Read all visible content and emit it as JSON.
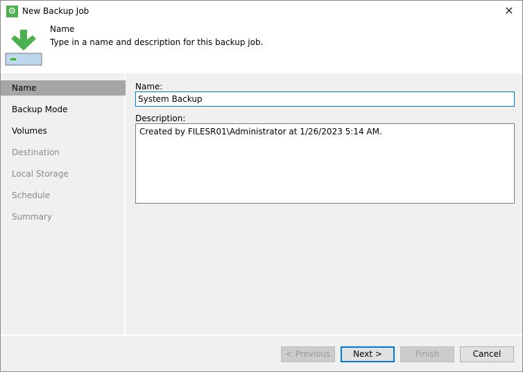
{
  "window": {
    "title": "New Backup Job"
  },
  "header": {
    "title": "Name",
    "description": "Type in a name and description for this backup job."
  },
  "steps": [
    {
      "label": "Name",
      "state": "selected"
    },
    {
      "label": "Backup Mode",
      "state": "enabled"
    },
    {
      "label": "Volumes",
      "state": "enabled"
    },
    {
      "label": "Destination",
      "state": "disabled"
    },
    {
      "label": "Local Storage",
      "state": "disabled"
    },
    {
      "label": "Schedule",
      "state": "disabled"
    },
    {
      "label": "Summary",
      "state": "disabled"
    }
  ],
  "form": {
    "name_label": "Name:",
    "name_value": "System Backup",
    "description_label": "Description:",
    "description_value": "Created by FILESR01\\Administrator at 1/26/2023 5:14 AM."
  },
  "buttons": {
    "previous": "< Previous",
    "next": "Next >",
    "finish": "Finish",
    "cancel": "Cancel"
  },
  "colors": {
    "accent": "#0078d7",
    "brand_green": "#4caf50"
  }
}
